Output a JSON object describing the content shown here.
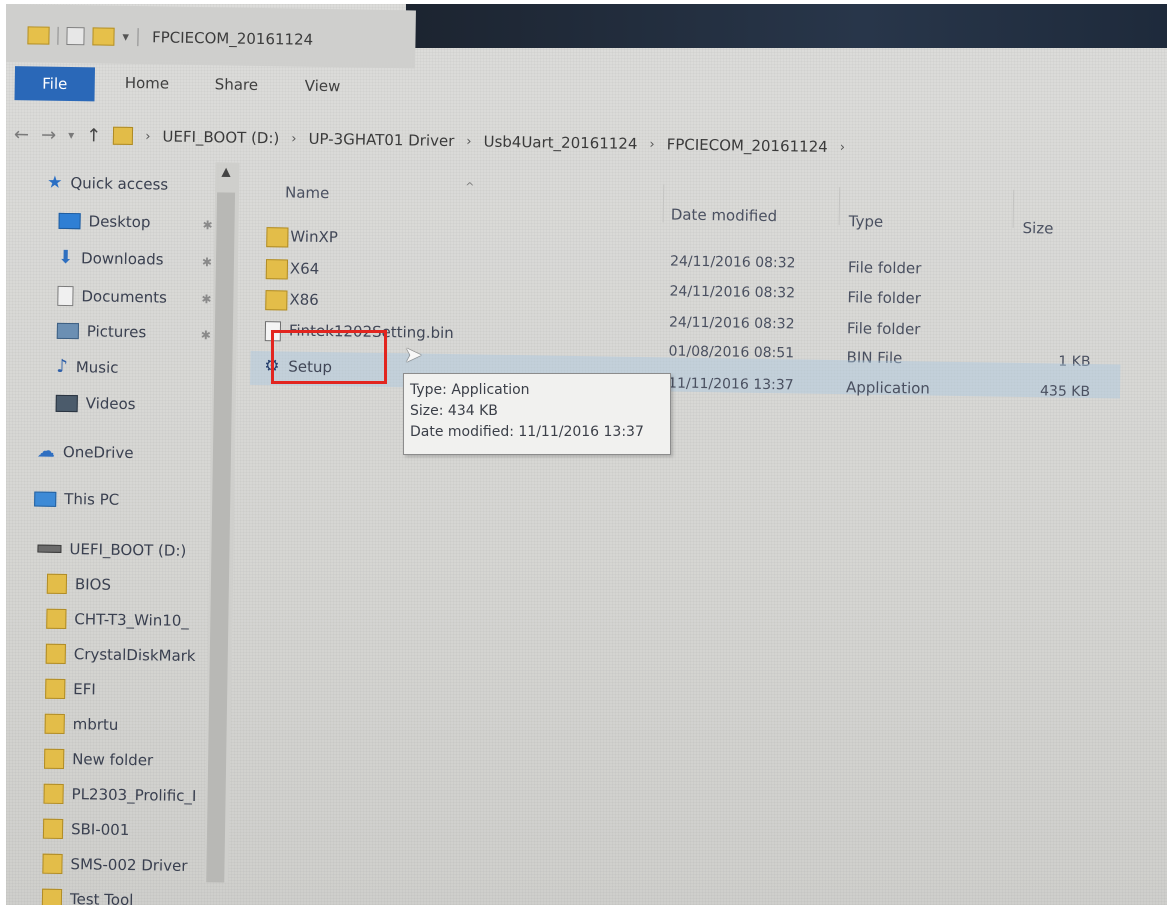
{
  "window": {
    "title": "FPCIECOM_20161124"
  },
  "ribbon": {
    "tabs": [
      "File",
      "Home",
      "Share",
      "View"
    ]
  },
  "address": {
    "crumbs": [
      "UEFI_BOOT (D:)",
      "UP-3GHAT01 Driver",
      "Usb4Uart_20161124",
      "FPCIECOM_20161124"
    ]
  },
  "nav": {
    "quick_access": "Quick access",
    "items": [
      {
        "label": "Desktop",
        "icon": "desktop-icon",
        "pinned": true
      },
      {
        "label": "Downloads",
        "icon": "downloads-icon",
        "pinned": true
      },
      {
        "label": "Documents",
        "icon": "documents-icon",
        "pinned": true
      },
      {
        "label": "Pictures",
        "icon": "pictures-icon",
        "pinned": true
      },
      {
        "label": "Music",
        "icon": "music-icon",
        "pinned": false
      },
      {
        "label": "Videos",
        "icon": "videos-icon",
        "pinned": false
      }
    ],
    "onedrive": "OneDrive",
    "this_pc": "This PC",
    "drive": "UEFI_BOOT (D:)",
    "drive_folders": [
      "BIOS",
      "CHT-T3_Win10_",
      "CrystalDiskMark",
      "EFI",
      "mbrtu",
      "New folder",
      "PL2303_Prolific_I",
      "SBI-001",
      "SMS-002 Driver",
      "Test Tool"
    ]
  },
  "columns": {
    "name": "Name",
    "date": "Date modified",
    "type": "Type",
    "size": "Size"
  },
  "files": [
    {
      "name": "WinXP",
      "date": "24/11/2016 08:32",
      "type": "File folder",
      "size": "",
      "kind": "folder"
    },
    {
      "name": "X64",
      "date": "24/11/2016 08:32",
      "type": "File folder",
      "size": "",
      "kind": "folder"
    },
    {
      "name": "X86",
      "date": "24/11/2016 08:32",
      "type": "File folder",
      "size": "",
      "kind": "folder"
    },
    {
      "name": "Fintek1202Setting.bin",
      "date": "01/08/2016 08:51",
      "type": "BIN File",
      "size": "1 KB",
      "kind": "bin"
    },
    {
      "name": "Setup",
      "date": "11/11/2016 13:37",
      "type": "Application",
      "size": "435 KB",
      "kind": "app"
    }
  ],
  "tooltip": {
    "type": "Type: Application",
    "size": "Size: 434 KB",
    "date": "Date modified: 11/11/2016 13:37"
  },
  "colors": {
    "highlight": "#e2251f",
    "file_tab": "#2a68b8",
    "selection": "#aac8e1"
  }
}
